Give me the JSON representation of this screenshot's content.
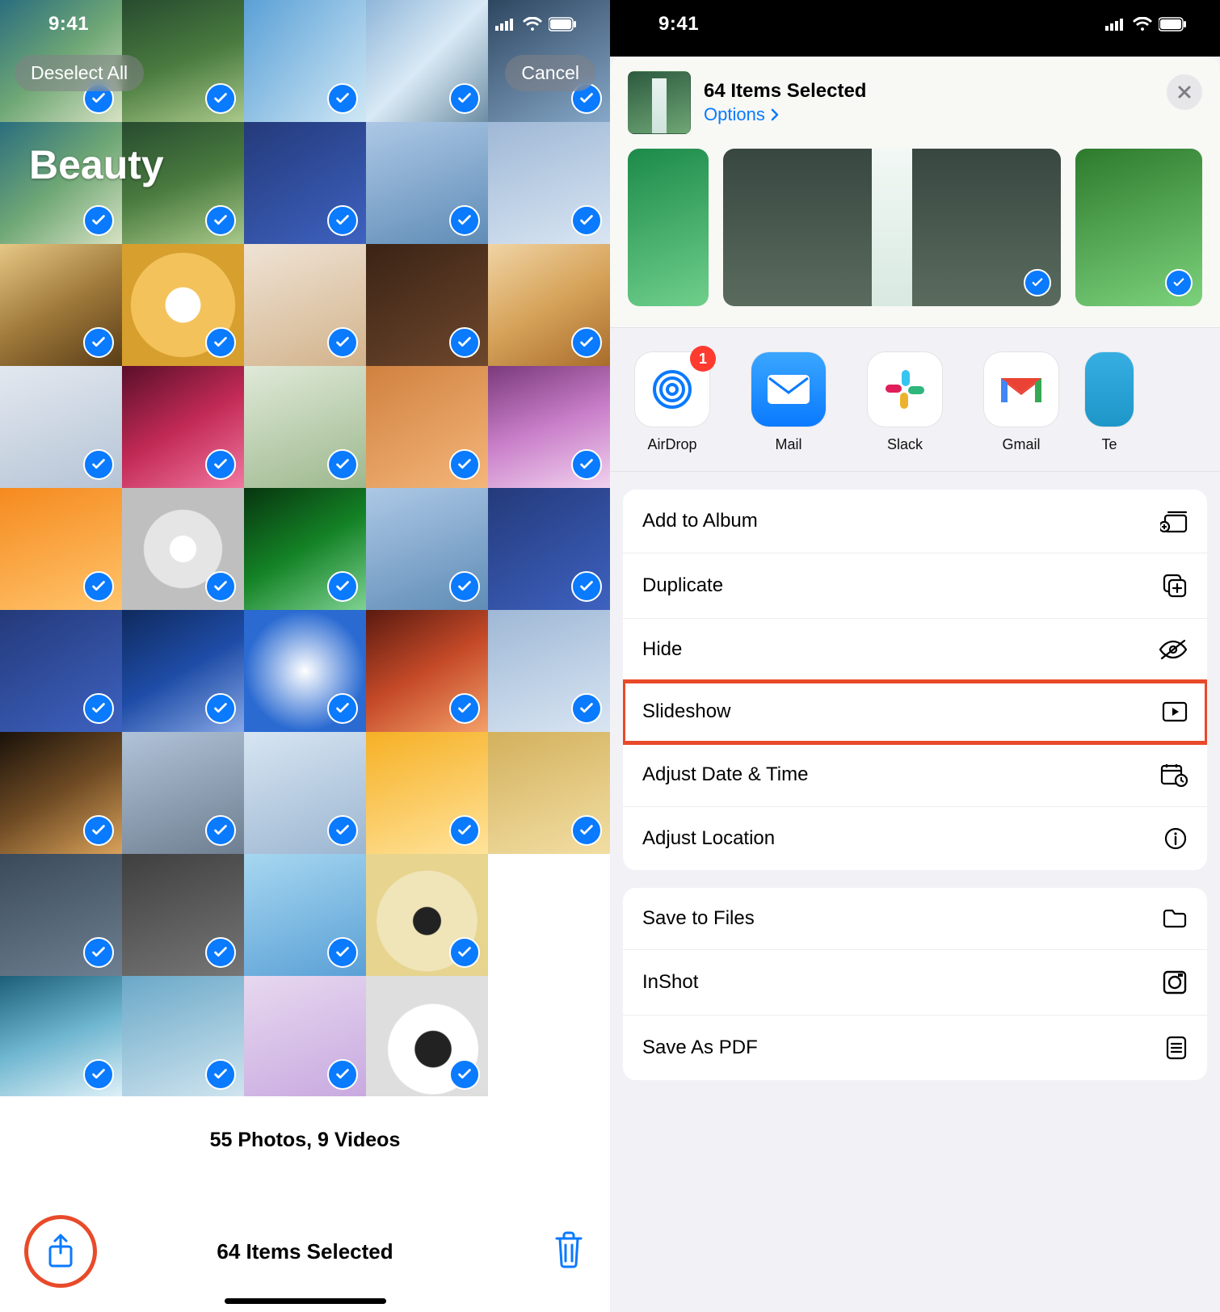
{
  "statusbar": {
    "time": "9:41"
  },
  "left": {
    "deselect_label": "Deselect All",
    "cancel_label": "Cancel",
    "album_title": "Beauty",
    "count_line": "55 Photos, 9 Videos",
    "selection_line": "64 Items Selected"
  },
  "share_sheet": {
    "title": "64 Items Selected",
    "options_label": "Options",
    "apps": {
      "airdrop": {
        "label": "AirDrop",
        "badge": "1"
      },
      "mail": {
        "label": "Mail"
      },
      "slack": {
        "label": "Slack"
      },
      "gmail": {
        "label": "Gmail"
      },
      "telegram": {
        "label": "Te"
      }
    },
    "actions_group1": {
      "add_to_album": "Add to Album",
      "duplicate": "Duplicate",
      "hide": "Hide",
      "slideshow": "Slideshow",
      "adjust_date": "Adjust Date & Time",
      "adjust_loc": "Adjust Location"
    },
    "actions_group2": {
      "save_files": "Save to Files",
      "inshot": "InShot",
      "save_pdf": "Save As PDF"
    }
  }
}
